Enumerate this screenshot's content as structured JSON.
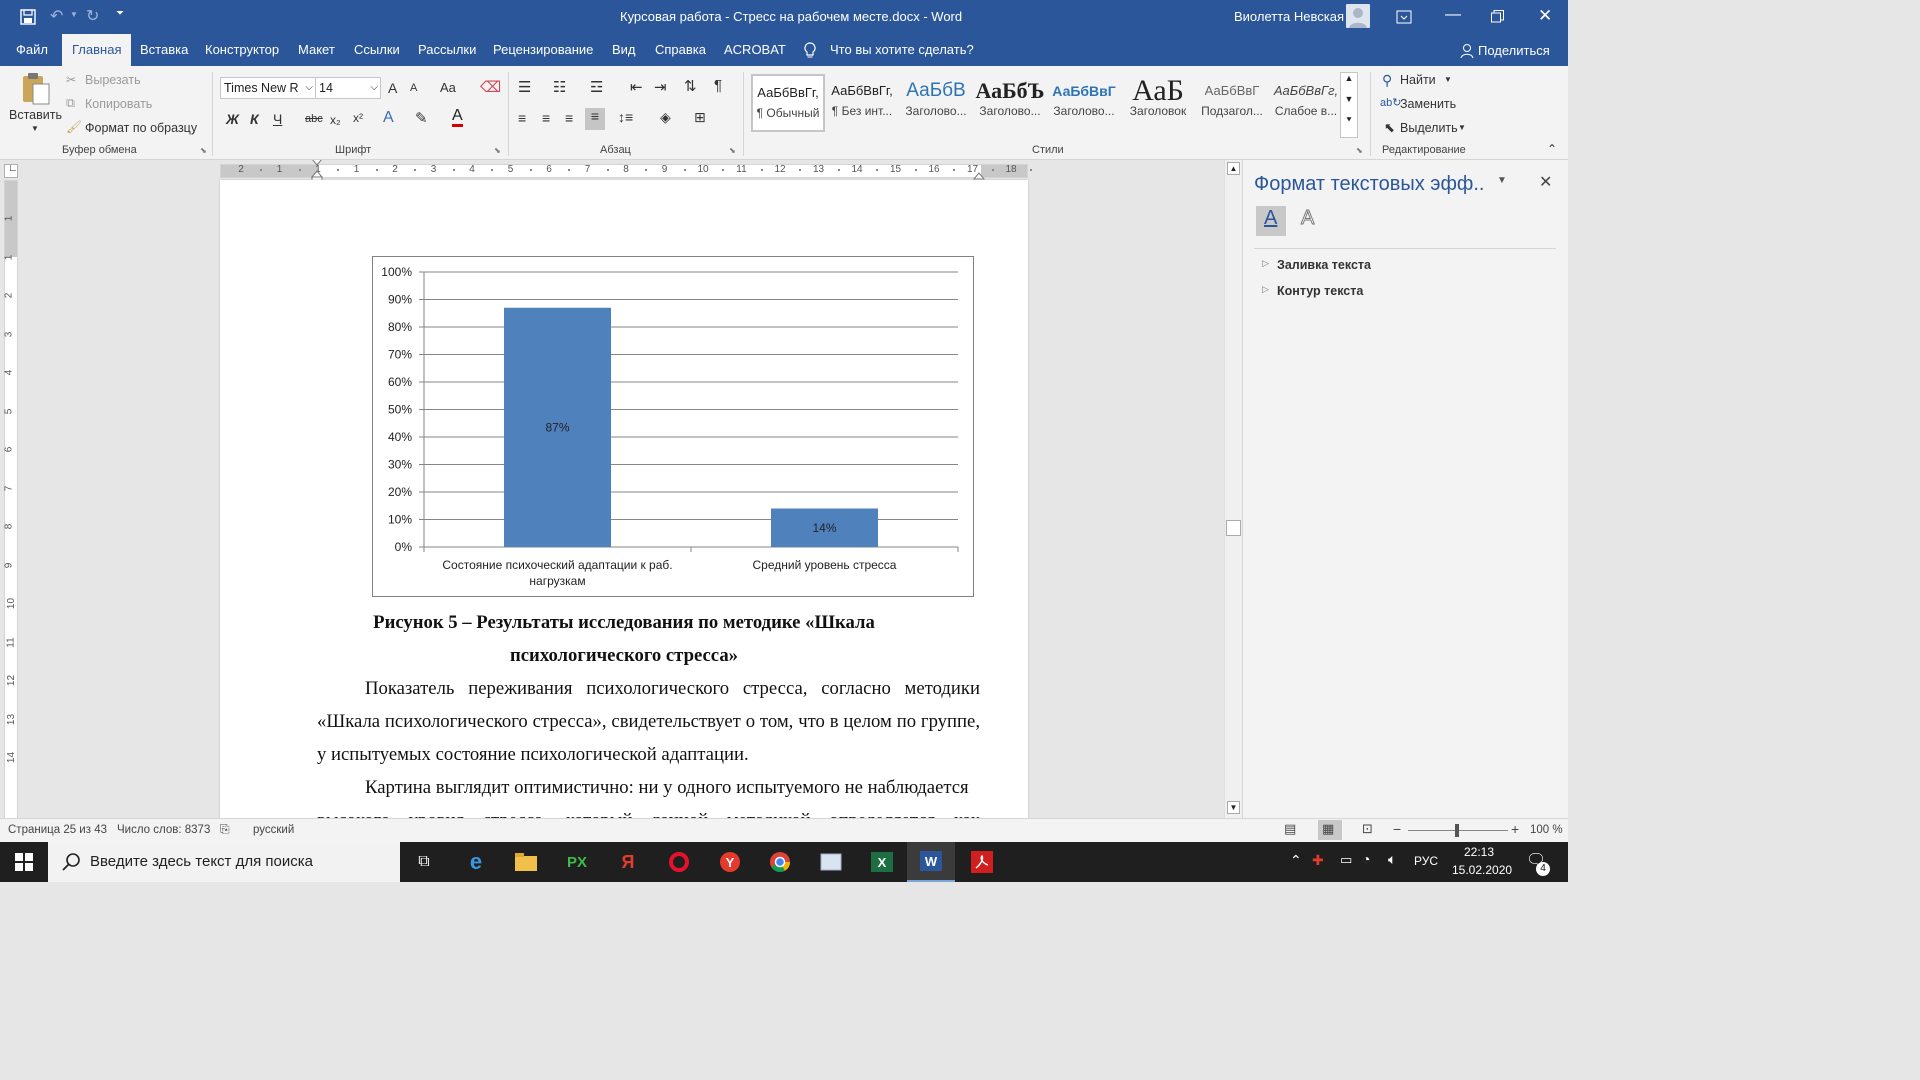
{
  "window": {
    "title": "Курсовая работа - Стресс на рабочем месте.docx  -  Word",
    "user": "Виолетта Невская"
  },
  "tabs": [
    "Файл",
    "Главная",
    "Вставка",
    "Конструктор",
    "Макет",
    "Ссылки",
    "Рассылки",
    "Рецензирование",
    "Вид",
    "Справка",
    "ACROBAT"
  ],
  "search_hint": "Что вы хотите сделать?",
  "share_label": "Поделиться",
  "clipboard": {
    "paste": "Вставить",
    "cut": "Вырезать",
    "copy": "Копировать",
    "format_painter": "Формат по образцу",
    "group": "Буфер обмена"
  },
  "font": {
    "name": "Times New R",
    "size": "14",
    "group": "Шрифт",
    "bold": "Ж",
    "italic": "К",
    "underline": "Ч",
    "strike": "abc",
    "sub": "x₂",
    "sup": "x²",
    "grow": "A",
    "shrink": "A",
    "case": "Aa"
  },
  "paragraph": {
    "group": "Абзац"
  },
  "styles": {
    "group": "Стили",
    "items": [
      {
        "preview": "АаБбВвГг,",
        "name": "¶ Обычный"
      },
      {
        "preview": "АаБбВвГг,",
        "name": "¶ Без инт..."
      },
      {
        "preview": "АаБбВ",
        "name": "Заголово..."
      },
      {
        "preview": "АаБбЪ",
        "name": "Заголово..."
      },
      {
        "preview": "АаБбВвГ",
        "name": "Заголово..."
      },
      {
        "preview": "АаБ",
        "name": "Заголовок"
      },
      {
        "preview": "АаБбВвГ",
        "name": "Подзагол..."
      },
      {
        "preview": "АаБбВвГг,",
        "name": "Слабое в..."
      }
    ]
  },
  "editing": {
    "find": "Найти",
    "replace": "Заменить",
    "select": "Выделить",
    "group": "Редактирование"
  },
  "ruler_numbers": [
    "2",
    "1",
    "1",
    "1",
    "2",
    "3",
    "4",
    "5",
    "6",
    "7",
    "8",
    "9",
    "10",
    "11",
    "12",
    "13",
    "14",
    "15",
    "16",
    "17",
    "18"
  ],
  "vruler_numbers": [
    "1",
    "1",
    "2",
    "3",
    "4",
    "5",
    "6",
    "7",
    "8",
    "9",
    "10",
    "11",
    "12",
    "13",
    "14"
  ],
  "chart_data": {
    "type": "bar",
    "categories": [
      "Состояние психоческий адаптации к раб. нагрузкам",
      "Средний уровень стресса"
    ],
    "category_lines": [
      [
        "Состояние психоческий адаптации к раб.",
        "нагрузкам"
      ],
      [
        "Средний уровень стресса"
      ]
    ],
    "values": [
      87,
      14
    ],
    "data_labels": [
      "87%",
      "14%"
    ],
    "y_ticks": [
      "0%",
      "10%",
      "20%",
      "30%",
      "40%",
      "50%",
      "60%",
      "70%",
      "80%",
      "90%",
      "100%"
    ],
    "ylim": [
      0,
      100
    ],
    "grid": true,
    "bar_color": "#4f81bd"
  },
  "document": {
    "caption_line1": "Рисунок 5 – Результаты исследования по методике «Шкала",
    "caption_line2": "психологического стресса»",
    "para1": "Показатель переживания психологического стресса, согласно методики «Шкала психологического стресса», свидетельствует о том, что в целом по группе, у испытуемых состояние психологической адаптации.",
    "para2_line1": "Картина выглядит оптимистично: ни у одного испытуемого не наблюдается",
    "para2_line2": "высокого уровня стресса, который данной методикой определяется как"
  },
  "pane": {
    "title": "Формат текстовых эфф..",
    "items": [
      "Заливка текста",
      "Контур текста"
    ]
  },
  "statusbar": {
    "page": "Страница 25 из 43",
    "words": "Число слов: 8373",
    "lang": "русский",
    "zoom": "100 %"
  },
  "taskbar": {
    "search_placeholder": "Введите здесь текст для поиска",
    "lang": "РУС",
    "time": "22:13",
    "date": "15.02.2020",
    "notif_count": "4"
  }
}
